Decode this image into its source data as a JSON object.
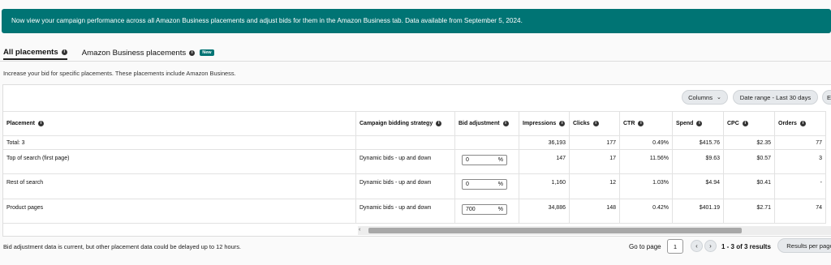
{
  "banner": {
    "text": "Now view your campaign performance across all Amazon Business placements and adjust bids for them in the Amazon Business tab. Data available from September 5, 2024."
  },
  "tabs": [
    {
      "label": "All placements",
      "active": true
    },
    {
      "label": "Amazon Business placements",
      "badge": "New",
      "active": false
    }
  ],
  "description": "Increase your bid for specific placements. These placements include Amazon Business.",
  "toolbar": {
    "columns_label": "Columns",
    "date_range_label": "Date range - Last 30 days",
    "export_label": "E"
  },
  "table": {
    "headers": [
      "Placement",
      "Campaign bidding strategy",
      "Bid adjustment",
      "Impressions",
      "Clicks",
      "CTR",
      "Spend",
      "CPC",
      "Orders"
    ],
    "total": {
      "label": "Total: 3",
      "impressions": "36,193",
      "clicks": "177",
      "ctr": "0.49%",
      "spend": "$415.76",
      "cpc": "$2.35",
      "orders": "77"
    },
    "rows": [
      {
        "placement": "Top of search (first page)",
        "strategy": "Dynamic bids - up and down",
        "bid": "0",
        "unit": "%",
        "impressions": "147",
        "clicks": "17",
        "ctr": "11.56%",
        "spend": "$9.63",
        "cpc": "$0.57",
        "orders": "3"
      },
      {
        "placement": "Rest of search",
        "strategy": "Dynamic bids - up and down",
        "bid": "0",
        "unit": "%",
        "impressions": "1,160",
        "clicks": "12",
        "ctr": "1.03%",
        "spend": "$4.94",
        "cpc": "$0.41",
        "orders": "-"
      },
      {
        "placement": "Product pages",
        "strategy": "Dynamic bids - up and down",
        "bid": "700",
        "unit": "%",
        "impressions": "34,886",
        "clicks": "148",
        "ctr": "0.42%",
        "spend": "$401.19",
        "cpc": "$2.71",
        "orders": "74"
      }
    ]
  },
  "footer": {
    "note": "Bid adjustment data is current, but other placement data could be delayed up to 12 hours.",
    "go_to_page": "Go to page",
    "page": "1",
    "results": "1 - 3 of 3 results",
    "results_per_page": "Results per page"
  }
}
